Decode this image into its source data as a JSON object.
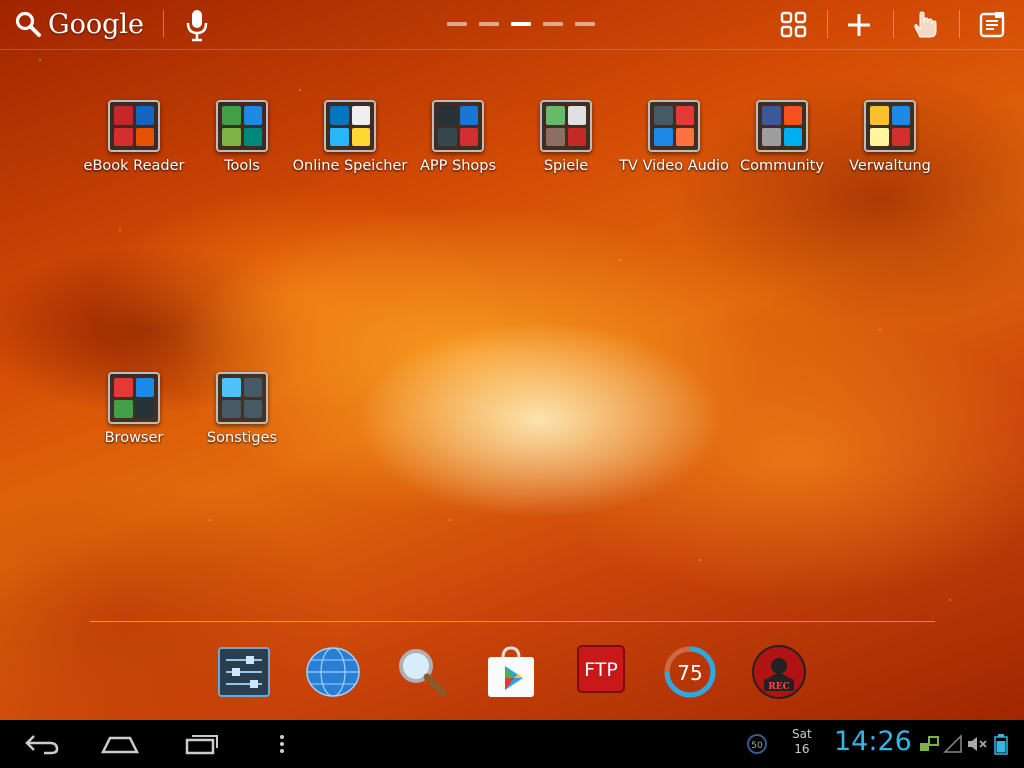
{
  "search": {
    "label": "Google"
  },
  "page_indicator": {
    "count": 5,
    "active_index": 2
  },
  "top_actions": [
    "apps-grid-icon",
    "add-icon",
    "gesture-hand-icon",
    "notes-icon"
  ],
  "desktop": {
    "folders": [
      {
        "label": "eBook Reader",
        "colors": [
          "#c62828",
          "#1565c0",
          "#d32f2f",
          "#e65100"
        ]
      },
      {
        "label": "Tools",
        "colors": [
          "#43a047",
          "#1e88e5",
          "#7cb342",
          "#00897b"
        ]
      },
      {
        "label": "Online Speicher",
        "colors": [
          "#0277bd",
          "#eeeeee",
          "#29b6f6",
          "#fdd835"
        ]
      },
      {
        "label": "APP Shops",
        "colors": [
          "#263238",
          "#1976d2",
          "#37474f",
          "#d32f2f"
        ]
      },
      {
        "label": "Spiele",
        "colors": [
          "#66bb6a",
          "#e0e0e0",
          "#8d6e63",
          "#c62828"
        ]
      },
      {
        "label": "TV Video Audio",
        "colors": [
          "#455a64",
          "#e53935",
          "#1e88e5",
          "#ff7043"
        ]
      },
      {
        "label": "Community",
        "colors": [
          "#3b5998",
          "#f4511e",
          "#9e9e9e",
          "#00aff0"
        ]
      },
      {
        "label": "Verwaltung",
        "colors": [
          "#fbc02d",
          "#1e88e5",
          "#fff59d",
          "#d32f2f"
        ]
      },
      {
        "label": "Browser",
        "colors": [
          "#e53935",
          "#1e88e5",
          "#43a047",
          "#263238"
        ]
      },
      {
        "label": "Sonstiges",
        "colors": [
          "#4fc3f7",
          "#455a64",
          "#455a64",
          "#455a64"
        ]
      }
    ]
  },
  "dock": [
    "settings-sliders-icon",
    "globe-icon",
    "magnifier-icon",
    "play-store-icon",
    "ftp-icon",
    "battery-75-icon",
    "rec-icon"
  ],
  "dock_labels": {
    "ftp": "FTP",
    "battery": "75",
    "rec": "REC"
  },
  "navbar": {
    "notification_badge": "50",
    "day": "Sat",
    "date": "16",
    "time": "14:26"
  },
  "colors": {
    "clock_accent": "#33b5e5",
    "navbar_bg": "#000000"
  }
}
